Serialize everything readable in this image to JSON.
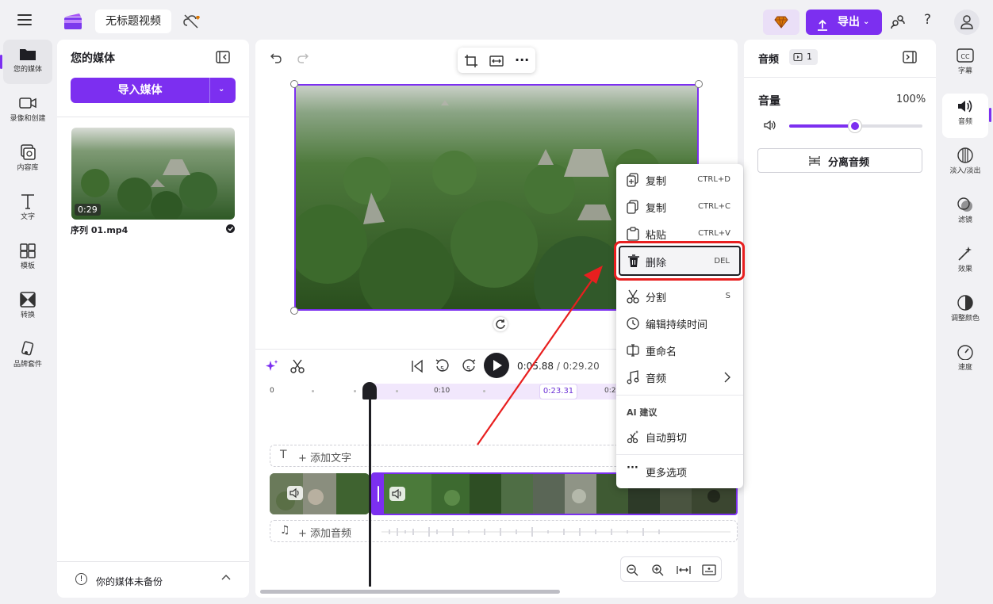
{
  "app": {
    "project_title": "无标题视频"
  },
  "header": {
    "export_label": "导出",
    "help_label": "?"
  },
  "left_rail": [
    {
      "label": "您的媒体",
      "icon": "folder-icon"
    },
    {
      "label": "录像和创建",
      "icon": "camera-icon"
    },
    {
      "label": "内容库",
      "icon": "library-icon"
    },
    {
      "label": "文字",
      "icon": "text-icon"
    },
    {
      "label": "模板",
      "icon": "template-icon"
    },
    {
      "label": "转换",
      "icon": "transition-icon"
    },
    {
      "label": "品牌套件",
      "icon": "brand-kit-icon"
    }
  ],
  "media": {
    "title": "您的媒体",
    "import_label": "导入媒体",
    "item": {
      "duration": "0:29",
      "filename": "序列 01.mp4"
    },
    "backup_text": "你的媒体未备份"
  },
  "player": {
    "skip_back_label": "5",
    "skip_fwd_label": "5",
    "current_time": "0:05.88",
    "total_time": "/ 0:29.20"
  },
  "timeline": {
    "ticks": [
      "0",
      "0:10",
      "0:2"
    ],
    "playhead_time": "0:23.31",
    "add_text_label": "+ 添加文字",
    "add_audio_label": "+ 添加音频"
  },
  "context_menu": {
    "items": [
      {
        "label": "复制",
        "shortcut": "CTRL+D",
        "icon": "duplicate-icon"
      },
      {
        "label": "复制",
        "shortcut": "CTRL+C",
        "icon": "copy-icon"
      },
      {
        "label": "粘贴",
        "shortcut": "CTRL+V",
        "icon": "paste-icon"
      },
      {
        "label": "删除",
        "shortcut": "DEL",
        "icon": "trash-icon"
      },
      {
        "label": "分割",
        "shortcut": "S",
        "icon": "scissors-icon"
      },
      {
        "label": "编辑持续时间",
        "shortcut": "",
        "icon": "clock-icon"
      },
      {
        "label": "重命名",
        "shortcut": "",
        "icon": "rename-icon"
      },
      {
        "label": "音频",
        "shortcut": "",
        "icon": "music-note-icon"
      }
    ],
    "ai_heading": "AI 建议",
    "ai_items": [
      {
        "label": "自动剪切",
        "icon": "auto-cut-icon"
      }
    ],
    "more_label": "更多选项"
  },
  "properties": {
    "title": "音频",
    "badge_count": "1",
    "volume_label": "音量",
    "volume_value": "100%",
    "volume_level": 0.5,
    "detach_audio_label": "分离音频"
  },
  "right_rail": [
    {
      "label": "字幕",
      "icon": "captions-icon"
    },
    {
      "label": "音频",
      "icon": "speaker-icon"
    },
    {
      "label": "淡入/淡出",
      "icon": "fade-icon"
    },
    {
      "label": "滤镜",
      "icon": "filter-icon"
    },
    {
      "label": "效果",
      "icon": "magic-wand-icon"
    },
    {
      "label": "调整颜色",
      "icon": "color-adjust-icon"
    },
    {
      "label": "速度",
      "icon": "speed-icon"
    }
  ],
  "colors": {
    "accent": "#7c2ff0",
    "annotation": "#e81f1f"
  }
}
